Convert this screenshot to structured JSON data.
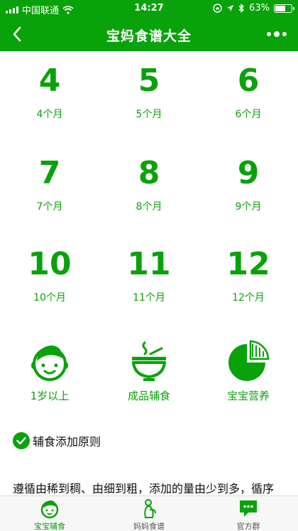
{
  "status_bar": {
    "carrier": "中国联通",
    "time": "14:27",
    "battery": "63%"
  },
  "nav": {
    "title": "宝妈食谱大全"
  },
  "months": [
    {
      "num": "4",
      "label": "4个月"
    },
    {
      "num": "5",
      "label": "5个月"
    },
    {
      "num": "6",
      "label": "6个月"
    },
    {
      "num": "7",
      "label": "7个月"
    },
    {
      "num": "8",
      "label": "8个月"
    },
    {
      "num": "9",
      "label": "9个月"
    },
    {
      "num": "10",
      "label": "10个月"
    },
    {
      "num": "11",
      "label": "11个月"
    },
    {
      "num": "12",
      "label": "12个月"
    }
  ],
  "categories": [
    {
      "label": "1岁以上",
      "icon": "baby-face-icon"
    },
    {
      "label": "成品辅食",
      "icon": "bowl-icon"
    },
    {
      "label": "宝宝营养",
      "icon": "pie-chart-icon"
    }
  ],
  "principle": {
    "title": "辅食添加原则",
    "text": "遵循由稀到稠、由细到粗，添加的量由少到多，循序"
  },
  "tabs": [
    {
      "label": "宝宝辅食",
      "icon": "baby-tab-icon",
      "active": true
    },
    {
      "label": "妈妈食谱",
      "icon": "mom-tab-icon",
      "active": false
    },
    {
      "label": "官方群",
      "icon": "chat-icon",
      "active": false
    }
  ],
  "colors": {
    "accent": "#0aa20a"
  }
}
